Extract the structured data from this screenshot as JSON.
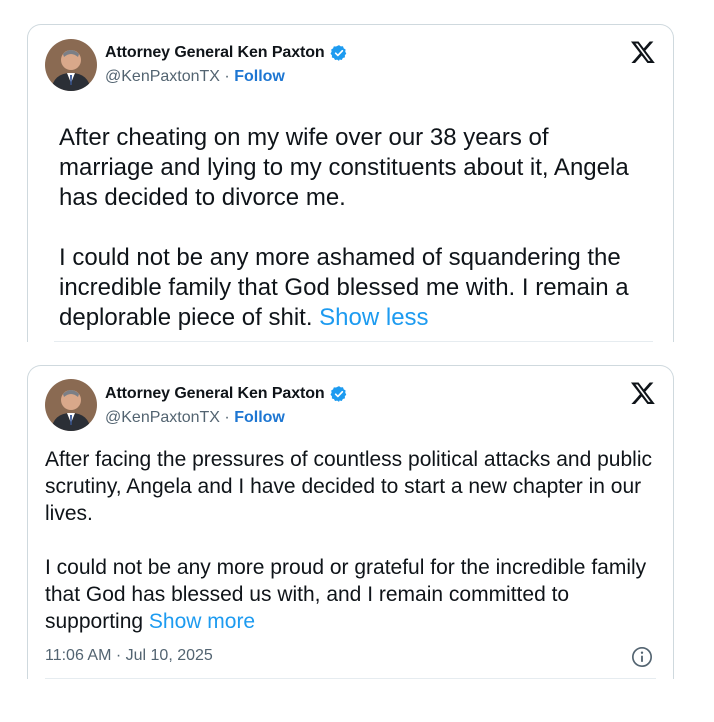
{
  "tweets": [
    {
      "author": {
        "name": "Attorney General Ken Paxton",
        "handle": "@KenPaxtonTX",
        "separator": "·",
        "follow_label": "Follow",
        "verified": true
      },
      "text": "After cheating on my wife over our 38 years of marriage and lying to my constituents about it, Angela has decided to divorce me.\n\nI could not be any more ashamed of squandering the incredible family that God blessed me with. I remain a deplorable piece of shit. ",
      "toggle_label": "Show less",
      "icons": {
        "avatar": "profile-photo",
        "verified": "verified-badge-icon",
        "platform": "x-logo-icon"
      }
    },
    {
      "author": {
        "name": "Attorney General Ken Paxton",
        "handle": "@KenPaxtonTX",
        "separator": "·",
        "follow_label": "Follow",
        "verified": true
      },
      "text": "After facing the pressures of countless political attacks and public scrutiny, Angela and I have decided to start a new chapter in our lives.\n\nI could not be any more proud or grateful for the incredible family that God has blessed us with, and I remain committed to supporting ",
      "toggle_label": "Show more",
      "timestamp": "11:06 AM · Jul 10, 2025",
      "icons": {
        "avatar": "profile-photo",
        "verified": "verified-badge-icon",
        "platform": "x-logo-icon",
        "info": "info-icon"
      }
    }
  ],
  "colors": {
    "link": "#1d9bf0",
    "follow": "#1d76d2",
    "verified": "#1d9bf0",
    "muted": "#536471",
    "border": "#cfd9de"
  }
}
